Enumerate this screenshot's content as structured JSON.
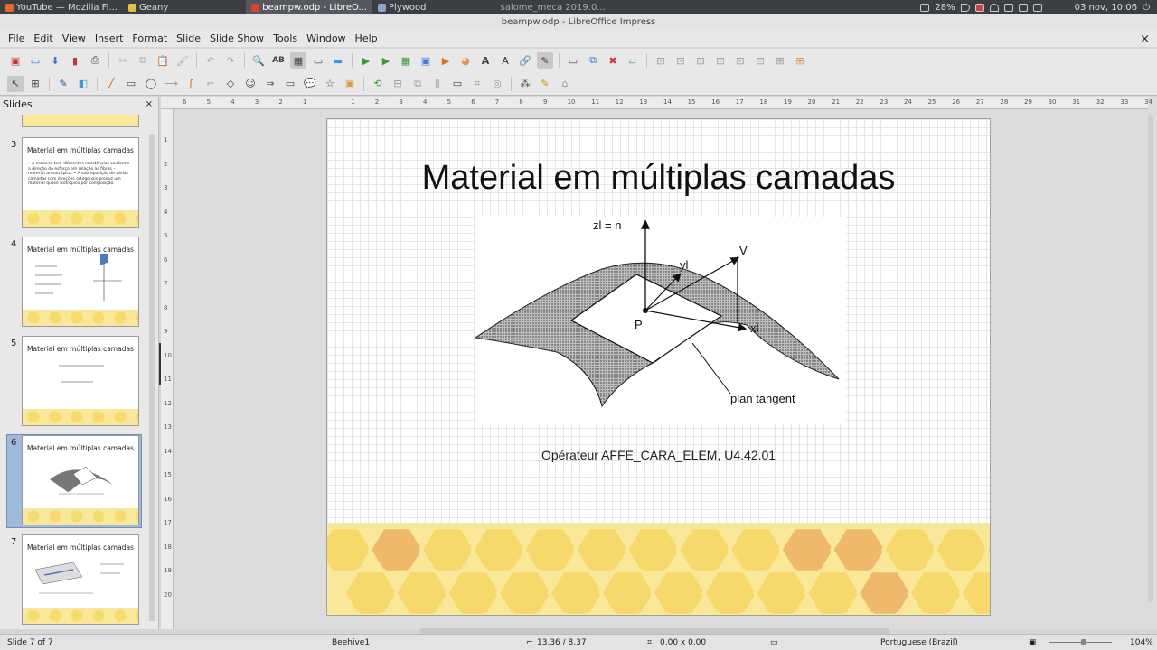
{
  "taskbar": {
    "items": [
      {
        "label": "YouTube — Mozilla Fi..."
      },
      {
        "label": "Geany"
      },
      {
        "label": "beampw.odp - LibreO..."
      },
      {
        "label": "Plywood"
      },
      {
        "label": "salome_meca 2019.0..."
      }
    ],
    "battery": "28%",
    "clock": "03 nov, 10:06"
  },
  "window": {
    "title": "beampw.odp - LibreOffice Impress"
  },
  "menu": [
    "File",
    "Edit",
    "View",
    "Insert",
    "Format",
    "Slide",
    "Slide Show",
    "Tools",
    "Window",
    "Help"
  ],
  "slides_pane": {
    "title": "Slides",
    "thumbs": [
      {
        "num": "3",
        "title": "Material em múltiplas camadas",
        "text": "• A madeira tem diferentes resistências conforme a direção do esforço em relação às fibras – material anisotrópico. • A sobreposição de várias camadas com direções ortogonais produz um material quase isotrópico por composição."
      },
      {
        "num": "4",
        "title": "Material em múltiplas camadas",
        "text": ""
      },
      {
        "num": "5",
        "title": "Material em múltiplas camadas",
        "text": ""
      },
      {
        "num": "6",
        "title": "Material em múltiplas camadas",
        "text": ""
      },
      {
        "num": "7",
        "title": "Material em múltiplas camadas",
        "text": ""
      }
    ]
  },
  "slide": {
    "title": "Material em múltiplas camadas",
    "caption": "Opérateur AFFE_CARA_ELEM, U4.42.01",
    "figure": {
      "z_label": "zl = n",
      "v_label": "V",
      "y_label": "yl",
      "x_label": "xl",
      "p_label": "P",
      "tangent_label": "plan tangent"
    }
  },
  "ruler": {
    "h_ticks": [
      "6",
      "5",
      "4",
      "3",
      "2",
      "1",
      "",
      "1",
      "2",
      "3",
      "4",
      "5",
      "6",
      "7",
      "8",
      "9",
      "10",
      "11",
      "12",
      "13",
      "14",
      "15",
      "16",
      "17",
      "18",
      "19",
      "20",
      "21",
      "22",
      "23",
      "24",
      "25",
      "26",
      "27",
      "28",
      "29",
      "30",
      "31",
      "32",
      "33",
      "34"
    ],
    "v_ticks": [
      "1",
      "2",
      "3",
      "4",
      "5",
      "6",
      "7",
      "8",
      "9",
      "10",
      "11",
      "12",
      "13",
      "14",
      "15",
      "16",
      "17",
      "18",
      "19",
      "20"
    ]
  },
  "status": {
    "slide_of": "Slide 7 of 7",
    "master": "Beehive1",
    "position": "13,36 / 8,37",
    "size": "0,00 x 0,00",
    "language": "Portuguese (Brazil)",
    "zoom": "104%"
  },
  "colors": {
    "honey_light": "#f9e79a",
    "honey_mid": "#f6d96a",
    "honey_dark": "#f0b86b",
    "selection": "#9fb9d9"
  }
}
